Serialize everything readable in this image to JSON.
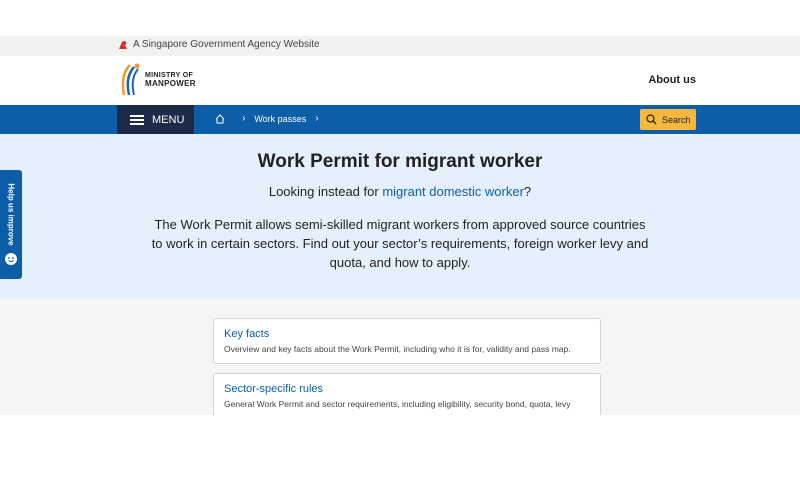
{
  "gov_banner": {
    "text": "A Singapore Government Agency Website"
  },
  "logo": {
    "line1": "MINISTRY OF",
    "line2": "MANPOWER"
  },
  "header": {
    "about_label": "About us"
  },
  "nav": {
    "menu_label": "MENU",
    "breadcrumb": [
      "Work passes"
    ],
    "search_label": "Search"
  },
  "hero": {
    "title": "Work Permit for migrant worker",
    "alt_prefix": "Looking instead for ",
    "alt_link": "migrant domestic worker",
    "alt_suffix": "?",
    "description": "The Work Permit allows semi-skilled migrant workers from approved source countries to work in certain sectors. Find out your sector’s requirements, foreign worker levy and quota, and how to apply."
  },
  "feedback_tab": {
    "label": "Help us improve"
  },
  "cards": [
    {
      "title": "Key facts",
      "description": "Overview and key facts about the Work Permit, including who it is for, validity and pass map."
    },
    {
      "title": "Sector-specific rules",
      "description": "General Work Permit and sector requirements, including eligibility, security bond, quota, levy"
    }
  ],
  "colors": {
    "brand_blue": "#0d5ea8",
    "menu_dark": "#1e2a4a",
    "search_yellow": "#f5b73d",
    "hero_bg": "#e4f1fd"
  }
}
